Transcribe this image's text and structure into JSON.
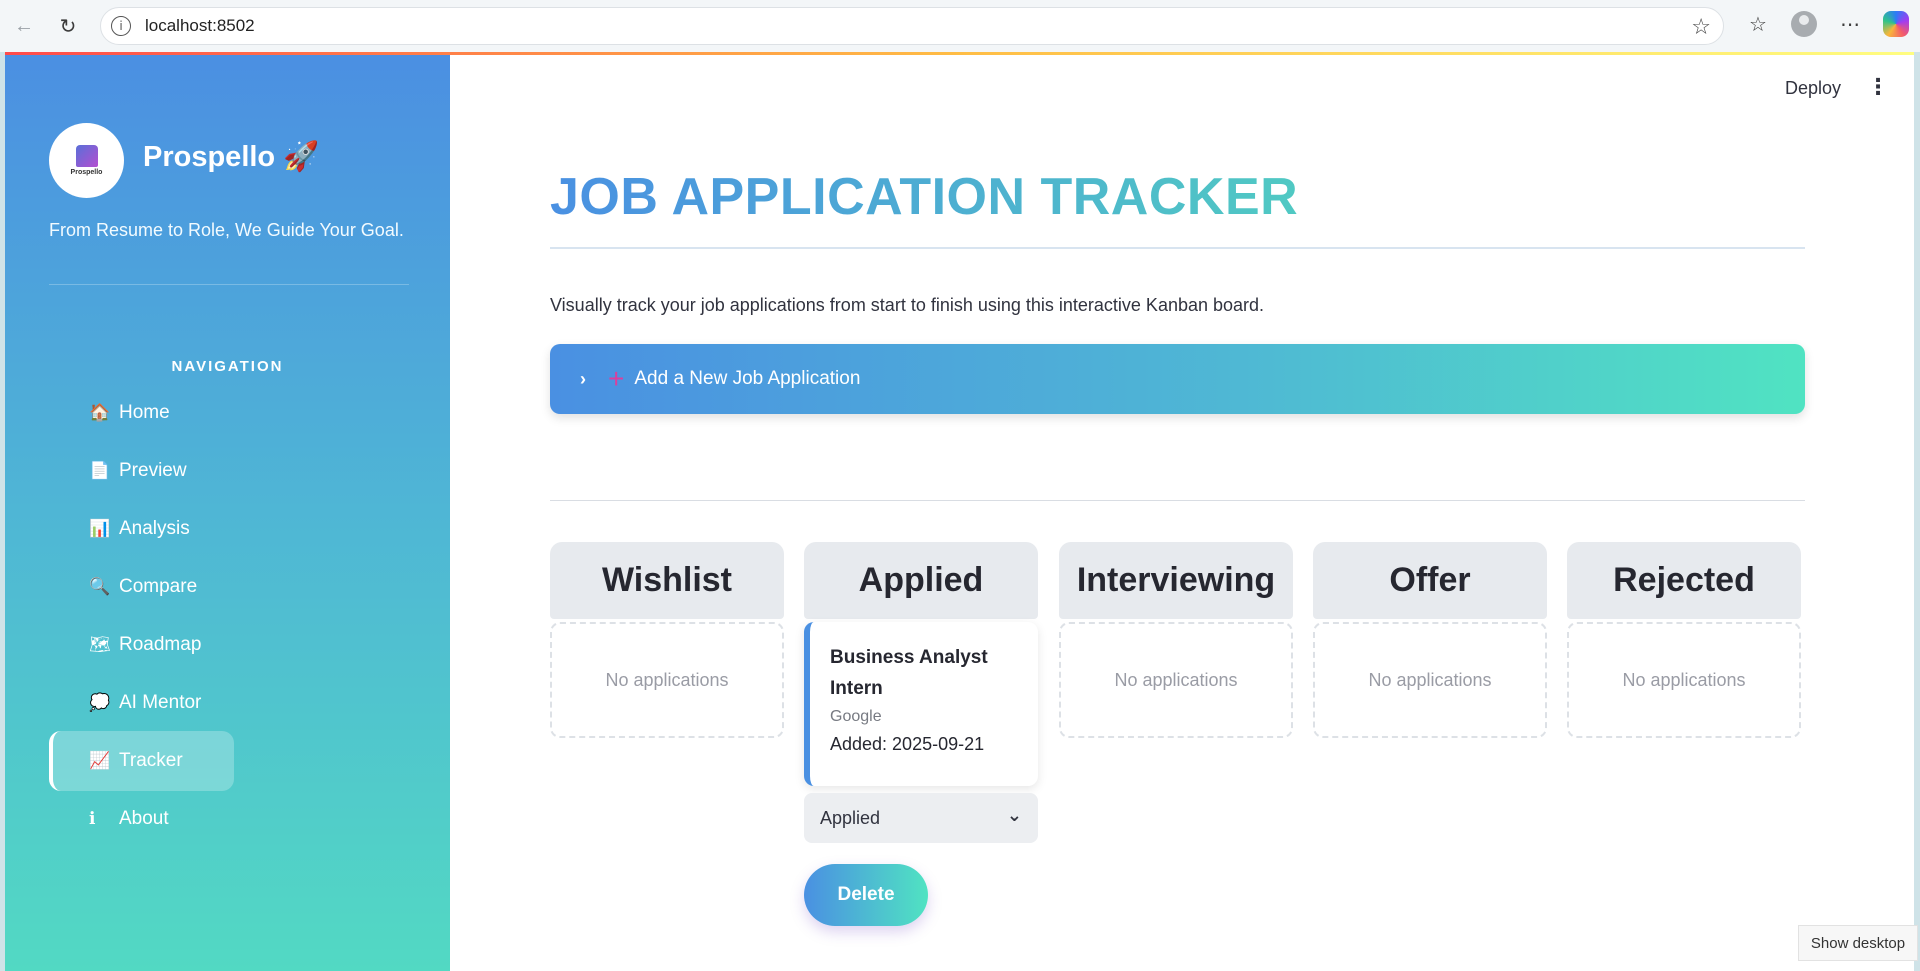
{
  "browser": {
    "url": "localhost:8502",
    "back_icon": "back-arrow-icon",
    "reload_icon": "reload-icon"
  },
  "sidebar": {
    "brand": "Prospello 🚀",
    "logo_text": "Prospello",
    "tagline": "From Resume to Role, We Guide Your Goal.",
    "nav_heading": "NAVIGATION",
    "items": [
      {
        "icon": "🏠",
        "label": "Home"
      },
      {
        "icon": "📄",
        "label": "Preview"
      },
      {
        "icon": "📊",
        "label": "Analysis"
      },
      {
        "icon": "🔍",
        "label": "Compare"
      },
      {
        "icon": "🗺",
        "label": "Roadmap"
      },
      {
        "icon": "💭",
        "label": "AI Mentor"
      },
      {
        "icon": "📈",
        "label": "Tracker",
        "active": true
      },
      {
        "icon": "ℹ",
        "label": "About"
      }
    ]
  },
  "header": {
    "deploy_label": "Deploy",
    "menu_label": "⋮"
  },
  "main": {
    "title": "JOB APPLICATION TRACKER",
    "description": "Visually track your job applications from start to finish using this interactive Kanban board.",
    "expander_label": "Add a New Job Application",
    "empty_label": "No applications",
    "columns": [
      {
        "title": "Wishlist"
      },
      {
        "title": "Applied"
      },
      {
        "title": "Interviewing"
      },
      {
        "title": "Offer"
      },
      {
        "title": "Rejected"
      }
    ],
    "card": {
      "title": "Business Analyst Intern",
      "company": "Google",
      "added": "Added: 2025-09-21",
      "status": "Applied",
      "delete_label": "Delete"
    }
  },
  "taskbar": {
    "show_desktop": "Show desktop"
  },
  "colors": {
    "sidebar_top": "#4b8fe2",
    "sidebar_bottom": "#52d9c3",
    "accent_blue": "#4a90e2",
    "accent_teal": "#50e3c2"
  }
}
